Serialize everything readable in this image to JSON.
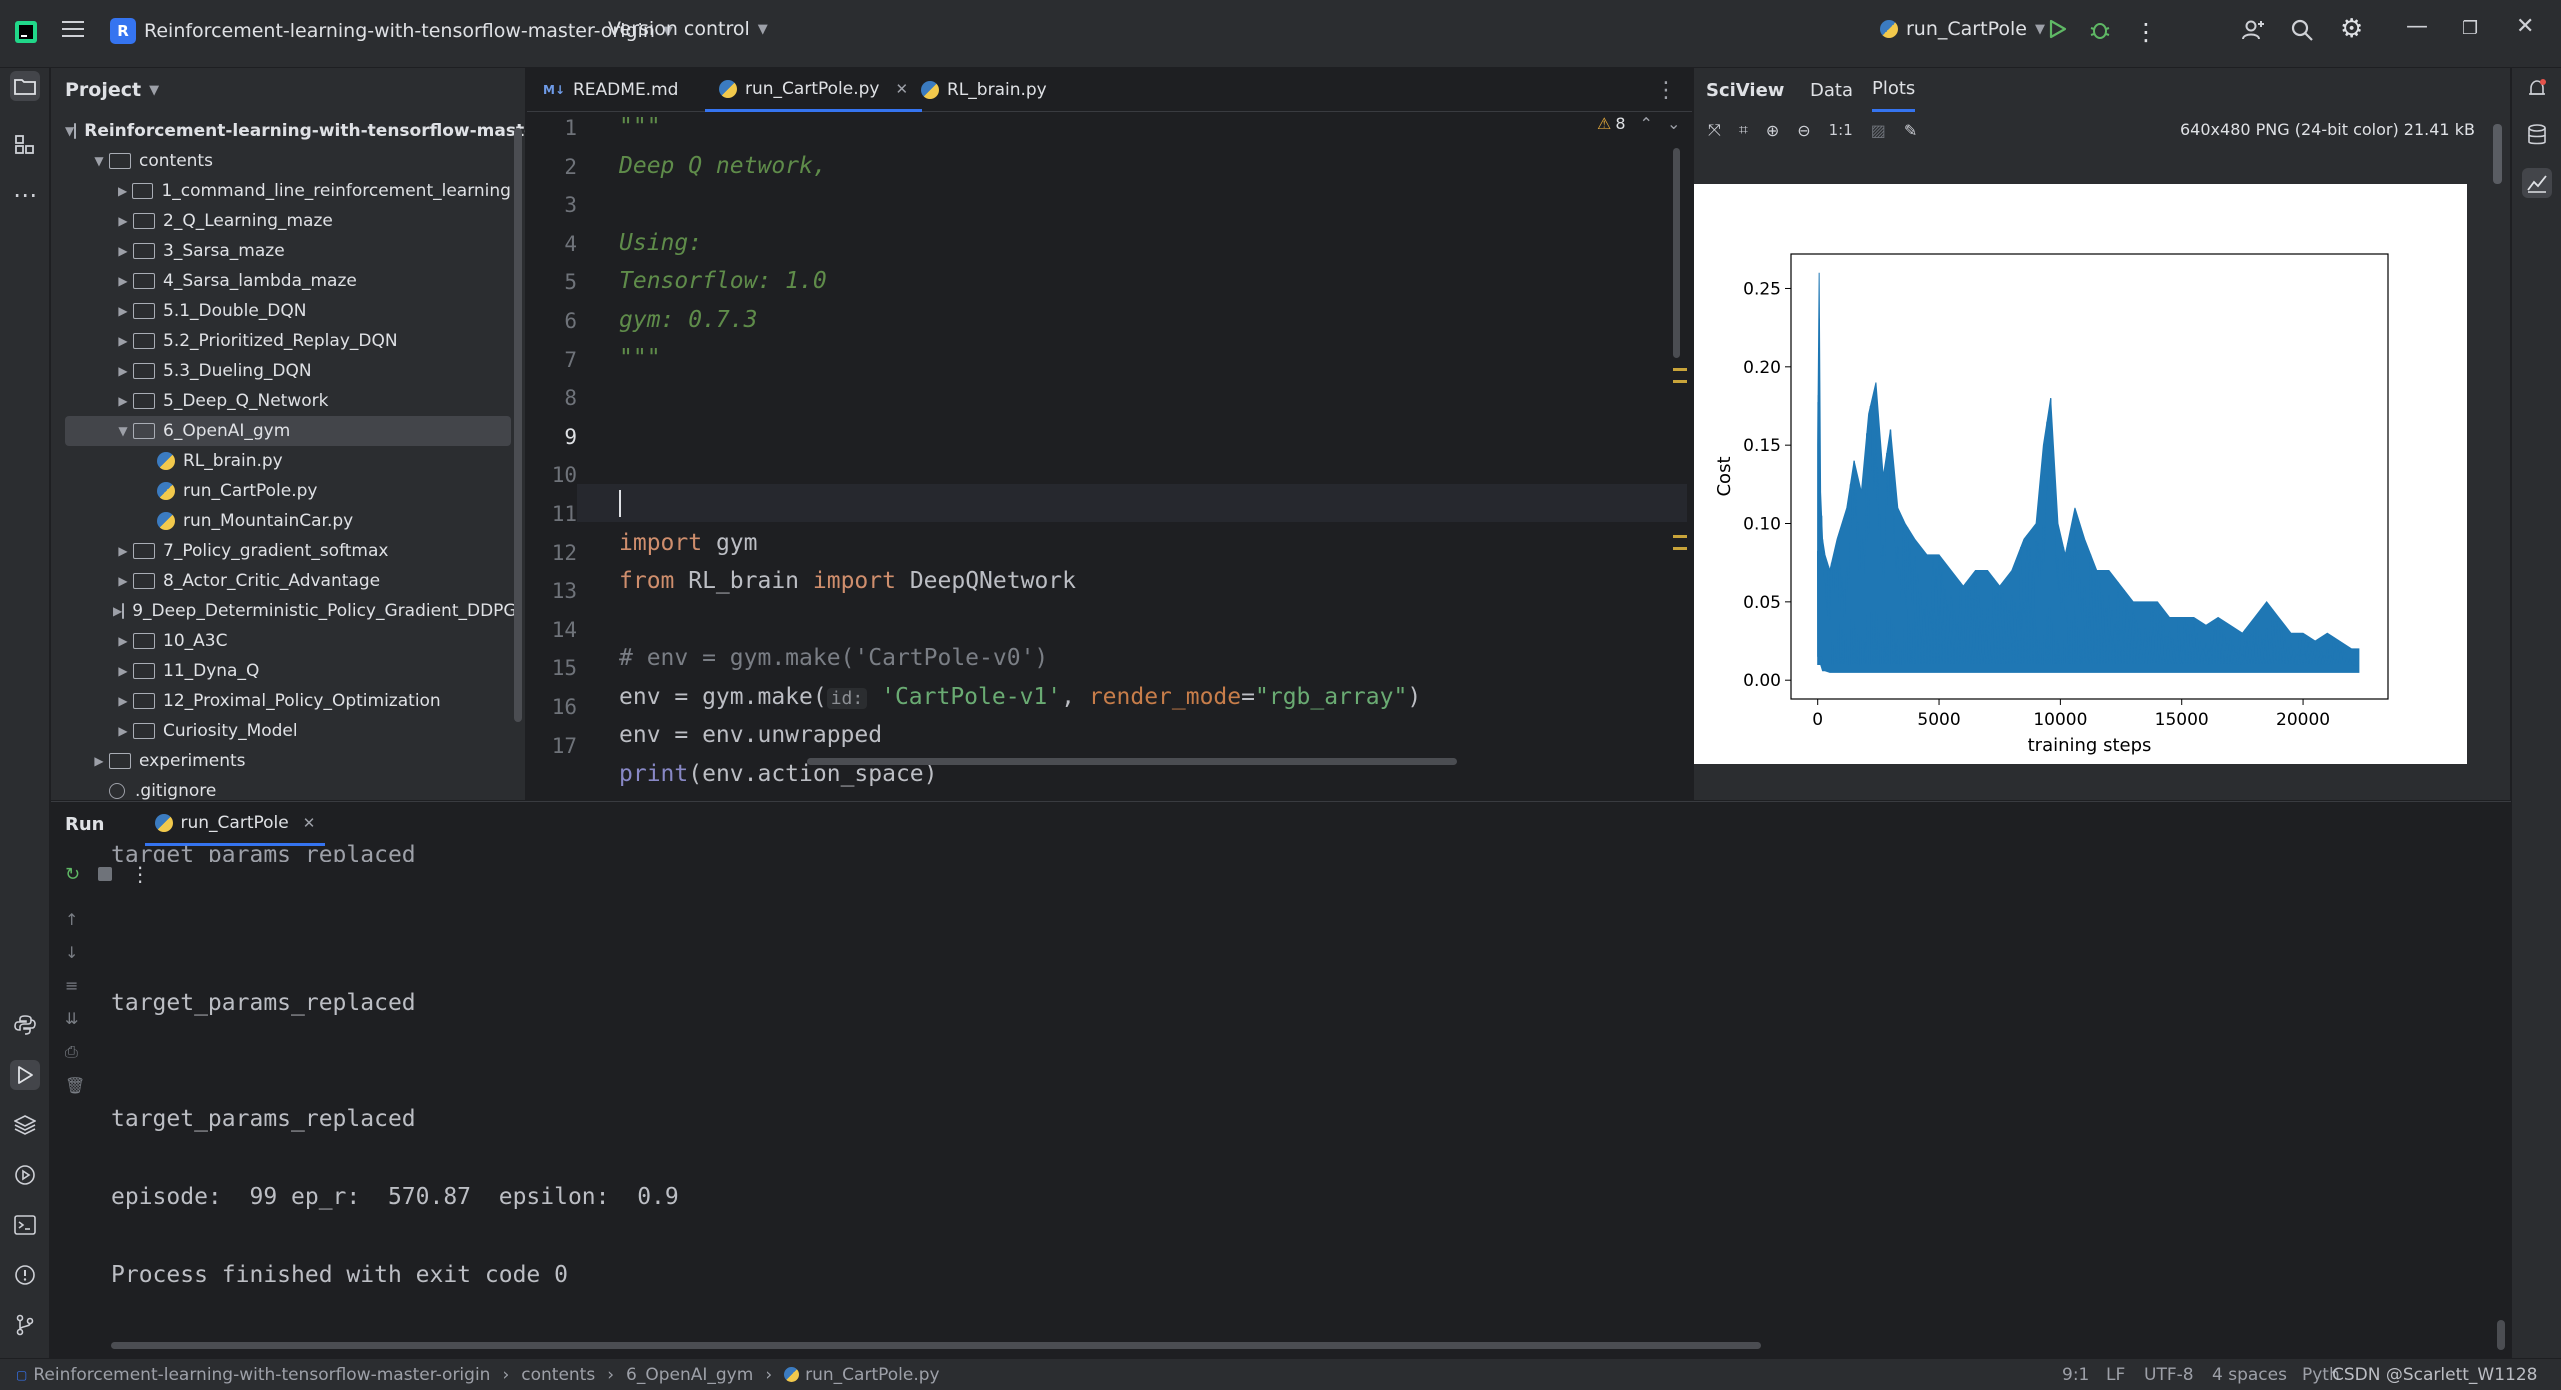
{
  "titlebar": {
    "project_badge": "R",
    "project_name": "Reinforcement-learning-with-tensorflow-master-origin",
    "vcs": "Version control",
    "run_config": "run_CartPole"
  },
  "project_panel": {
    "title": "Project",
    "root": "Reinforcement-learning-with-tensorflow-maste",
    "items": [
      {
        "label": "contents",
        "depth": 1,
        "type": "folder",
        "expanded": true
      },
      {
        "label": "1_command_line_reinforcement_learning",
        "depth": 2,
        "type": "folder"
      },
      {
        "label": "2_Q_Learning_maze",
        "depth": 2,
        "type": "folder"
      },
      {
        "label": "3_Sarsa_maze",
        "depth": 2,
        "type": "folder"
      },
      {
        "label": "4_Sarsa_lambda_maze",
        "depth": 2,
        "type": "folder"
      },
      {
        "label": "5.1_Double_DQN",
        "depth": 2,
        "type": "folder"
      },
      {
        "label": "5.2_Prioritized_Replay_DQN",
        "depth": 2,
        "type": "folder"
      },
      {
        "label": "5.3_Dueling_DQN",
        "depth": 2,
        "type": "folder"
      },
      {
        "label": "5_Deep_Q_Network",
        "depth": 2,
        "type": "folder"
      },
      {
        "label": "6_OpenAI_gym",
        "depth": 2,
        "type": "folder",
        "expanded": true,
        "selected": true
      },
      {
        "label": "RL_brain.py",
        "depth": 3,
        "type": "py"
      },
      {
        "label": "run_CartPole.py",
        "depth": 3,
        "type": "py"
      },
      {
        "label": "run_MountainCar.py",
        "depth": 3,
        "type": "py"
      },
      {
        "label": "7_Policy_gradient_softmax",
        "depth": 2,
        "type": "folder"
      },
      {
        "label": "8_Actor_Critic_Advantage",
        "depth": 2,
        "type": "folder"
      },
      {
        "label": "9_Deep_Deterministic_Policy_Gradient_DDPG",
        "depth": 2,
        "type": "folder"
      },
      {
        "label": "10_A3C",
        "depth": 2,
        "type": "folder"
      },
      {
        "label": "11_Dyna_Q",
        "depth": 2,
        "type": "folder"
      },
      {
        "label": "12_Proximal_Policy_Optimization",
        "depth": 2,
        "type": "folder"
      },
      {
        "label": "Curiosity_Model",
        "depth": 2,
        "type": "folder"
      },
      {
        "label": "experiments",
        "depth": 1,
        "type": "folder"
      },
      {
        "label": ".gitignore",
        "depth": 1,
        "type": "ignore"
      }
    ]
  },
  "editor": {
    "tabs": [
      {
        "label": "README.md",
        "active": false,
        "icon": "markdown-icon"
      },
      {
        "label": "run_CartPole.py",
        "active": true,
        "icon": "python-icon"
      },
      {
        "label": "RL_brain.py",
        "active": false,
        "icon": "python-icon"
      }
    ],
    "inspection_count": "8",
    "line_numbers": [
      "1",
      "2",
      "3",
      "4",
      "5",
      "6",
      "7",
      "8",
      "9",
      "10",
      "11",
      "12",
      "13",
      "14",
      "15",
      "16",
      "17"
    ],
    "current_line": "9",
    "lines": {
      "l1": "\"\"\"",
      "l2": "Deep Q network,",
      "l4": "Using:",
      "l5": "Tensorflow: 1.0",
      "l6": "gym: 0.7.3",
      "l7": "\"\"\"",
      "l10_kw": "import",
      "l10_rest": " gym",
      "l11_kw1": "from",
      "l11_mod": " RL_brain ",
      "l11_kw2": "import",
      "l11_rest": " DeepQNetwork",
      "l13": "# env = gym.make('CartPole-v0')",
      "l14_a": "env = gym.make(",
      "l14_hint": "id:",
      "l14_str": "'CartPole-v1'",
      "l14_comma": ", ",
      "l14_param": "render_mode",
      "l14_eq": "=",
      "l14_str2": "\"rgb_array\"",
      "l14_close": ")",
      "l15": "env = env.unwrapped",
      "l17_fn": "print",
      "l17_rest": "(env.action_space)"
    }
  },
  "sciview": {
    "title": "SciView",
    "tabs": [
      "Data",
      "Plots"
    ],
    "zoom_label": "1:1",
    "image_info": "640x480 PNG (24-bit color) 21.41 kB"
  },
  "chart_data": {
    "type": "line",
    "title": "",
    "xlabel": "training steps",
    "ylabel": "Cost",
    "xlim": [
      -1100,
      23500
    ],
    "ylim": [
      -0.012,
      0.272
    ],
    "xticks": [
      0,
      5000,
      10000,
      15000,
      20000
    ],
    "yticks": [
      0.0,
      0.05,
      0.1,
      0.15,
      0.2,
      0.25
    ],
    "ytick_labels": [
      "0.00",
      "0.05",
      "0.10",
      "0.15",
      "0.20",
      "0.25"
    ],
    "series_color": "#1f77b4",
    "series": [
      {
        "x": [
          0,
          60,
          120,
          200,
          300,
          500,
          800,
          1200,
          1500,
          1800,
          2100,
          2400,
          2700,
          3000,
          3300,
          3600,
          4000,
          4500,
          5000,
          5500,
          6000,
          6500,
          7000,
          7500,
          8000,
          8500,
          9000,
          9300,
          9600,
          9900,
          10200,
          10600,
          11000,
          11500,
          12000,
          12500,
          13000,
          13500,
          14000,
          14500,
          15000,
          15500,
          16000,
          16500,
          17000,
          17500,
          18000,
          18500,
          19000,
          19500,
          20000,
          20500,
          21000,
          21500,
          22000,
          22300
        ],
        "upper": [
          0.15,
          0.26,
          0.12,
          0.09,
          0.08,
          0.07,
          0.09,
          0.11,
          0.14,
          0.12,
          0.17,
          0.19,
          0.13,
          0.16,
          0.11,
          0.1,
          0.09,
          0.08,
          0.08,
          0.07,
          0.06,
          0.07,
          0.07,
          0.06,
          0.07,
          0.09,
          0.1,
          0.15,
          0.18,
          0.1,
          0.08,
          0.11,
          0.09,
          0.07,
          0.07,
          0.06,
          0.05,
          0.05,
          0.05,
          0.04,
          0.04,
          0.04,
          0.035,
          0.04,
          0.035,
          0.03,
          0.04,
          0.05,
          0.04,
          0.03,
          0.03,
          0.025,
          0.03,
          0.025,
          0.02,
          0.02
        ],
        "lower": [
          0.01,
          0.01,
          0.01,
          0.006,
          0.006,
          0.005,
          0.005,
          0.005,
          0.005,
          0.005,
          0.005,
          0.005,
          0.005,
          0.005,
          0.005,
          0.005,
          0.005,
          0.005,
          0.005,
          0.005,
          0.005,
          0.005,
          0.005,
          0.005,
          0.005,
          0.005,
          0.005,
          0.005,
          0.005,
          0.005,
          0.005,
          0.005,
          0.005,
          0.005,
          0.005,
          0.005,
          0.005,
          0.005,
          0.005,
          0.005,
          0.005,
          0.005,
          0.005,
          0.005,
          0.005,
          0.005,
          0.005,
          0.005,
          0.005,
          0.005,
          0.005,
          0.005,
          0.005,
          0.005,
          0.005,
          0.005
        ]
      }
    ]
  },
  "run_panel": {
    "title": "Run",
    "tab": "run_CartPole",
    "output": [
      "target_params_replaced",
      "target_params_replaced",
      "episode:  99 ep_r:  570.87  epsilon:  0.9",
      "Process finished with exit code 0"
    ]
  },
  "statusbar": {
    "crumbs": [
      "Reinforcement-learning-with-tensorflow-master-origin",
      "contents",
      "6_OpenAI_gym",
      "run_CartPole.py"
    ],
    "position": "9:1",
    "line_sep": "LF",
    "encoding": "UTF-8",
    "indent": "4 spaces",
    "interpreter": "Pyth",
    "watermark": "CSDN @Scarlett_W1128"
  }
}
